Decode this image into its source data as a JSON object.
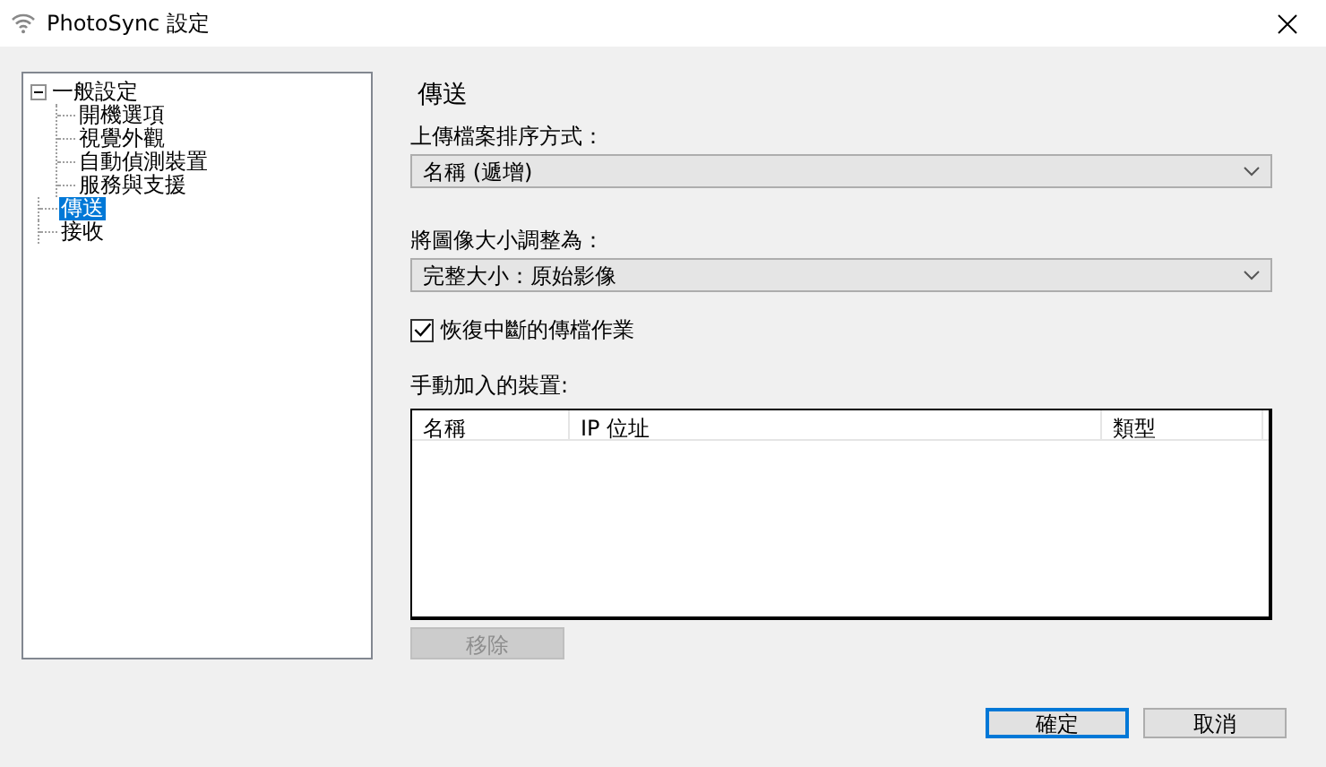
{
  "window": {
    "title": "PhotoSync 設定"
  },
  "tree": [
    {
      "label": "一般設定",
      "expanded": true,
      "selected": false,
      "children": [
        {
          "label": "開機選項",
          "selected": false
        },
        {
          "label": "視覺外觀",
          "selected": false
        },
        {
          "label": "自動偵測裝置",
          "selected": false
        },
        {
          "label": "服務與支援",
          "selected": false
        }
      ]
    },
    {
      "label": "傳送",
      "selected": true
    },
    {
      "label": "接收",
      "selected": false
    }
  ],
  "section": {
    "heading": "傳送",
    "fields": [
      {
        "label": "上傳檔案排序方式：",
        "value": "名稱 (遞增)"
      },
      {
        "label": "將圖像大小調整為：",
        "value": "完整大小：原始影像"
      }
    ],
    "resume_checkbox": {
      "label": "恢復中斷的傳檔作業",
      "checked": true
    },
    "devices": {
      "label": "手動加入的裝置:",
      "columns": [
        "名稱",
        "IP 位址",
        "類型"
      ]
    },
    "remove_button": {
      "label": "移除",
      "disabled": true
    }
  },
  "buttons": [
    {
      "label": "確定",
      "default": true
    },
    {
      "label": "取消",
      "default": false
    }
  ]
}
